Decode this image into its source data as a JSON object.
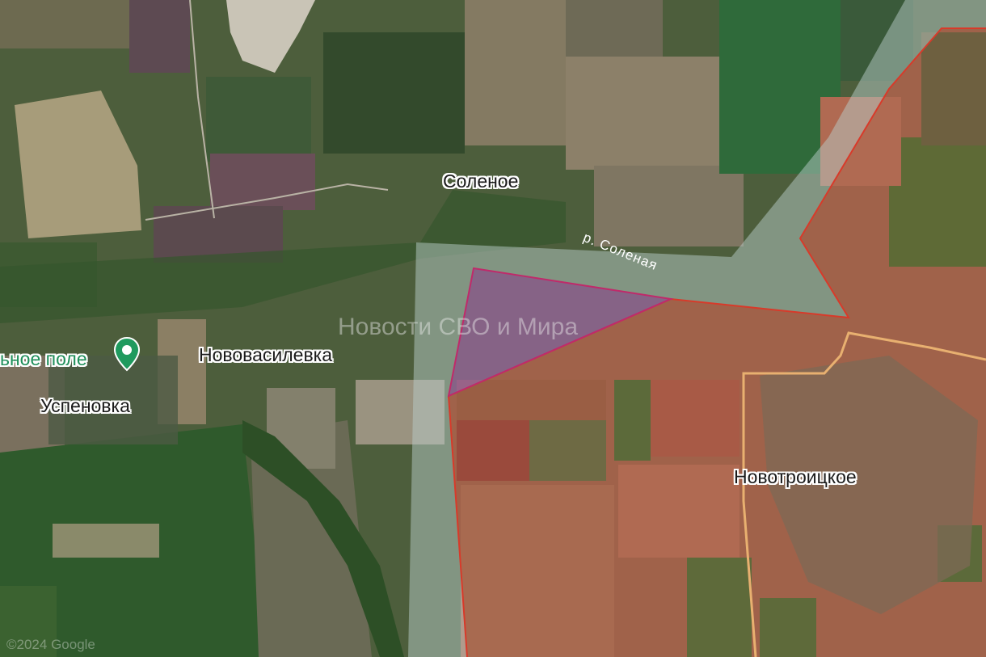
{
  "places": {
    "solenoe": "Соленое",
    "novovasilevka": "Нововасилевка",
    "uspenovka": "Успеновка",
    "novotroitskoe": "Новотроицкое",
    "poi": "ьное поле",
    "river": "р. Соленая"
  },
  "watermark": "Новости СВО и Мира",
  "copyright": "©2024 Google",
  "colors": {
    "control_red": "#d83a2a",
    "contested_grey": "#b8ccc8",
    "advance_purple": "#8a3a8a",
    "road_orange": "#e8b070",
    "poi_green": "#1f8f5a"
  },
  "icons": {
    "pin": "map-pin-icon"
  }
}
